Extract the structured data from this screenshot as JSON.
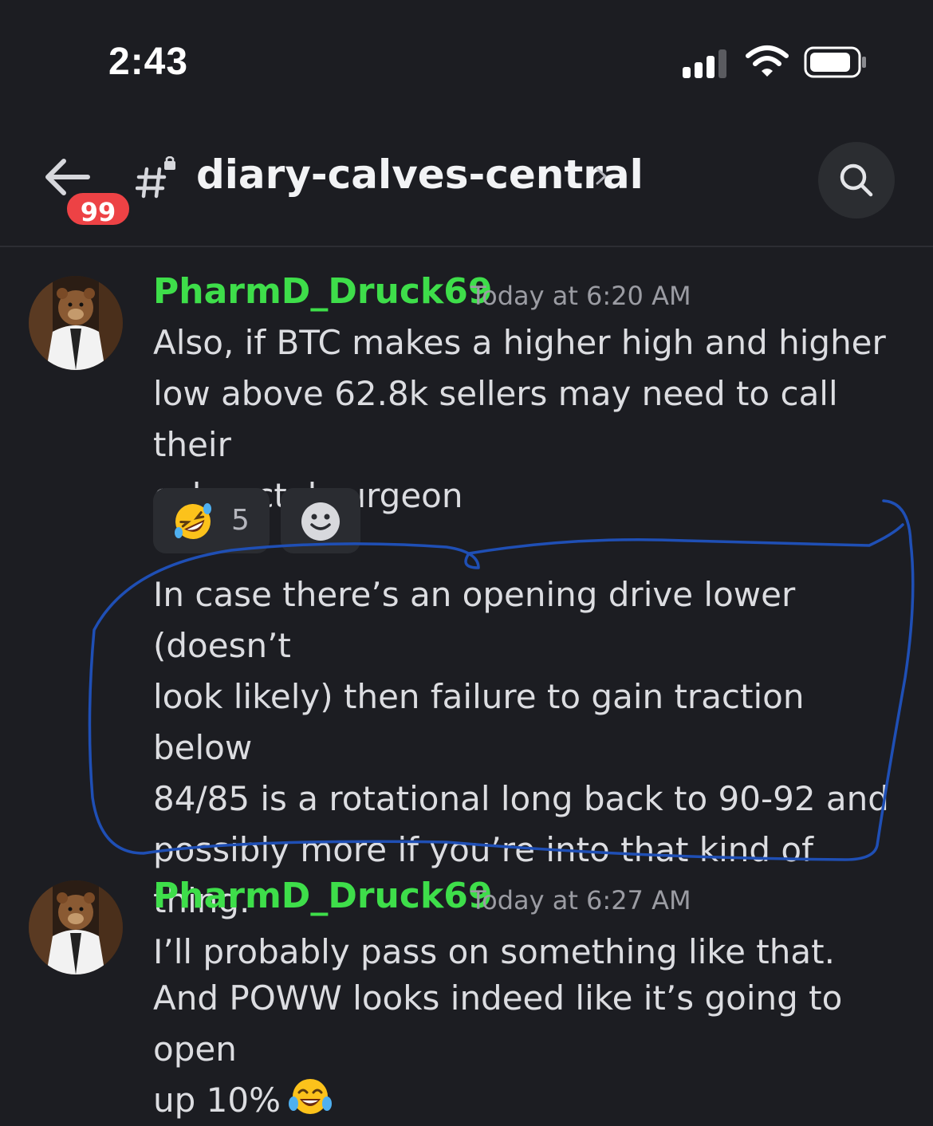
{
  "status_bar": {
    "time": "2:43"
  },
  "header": {
    "unread_badge": "99",
    "channel_name": "diary-calves-central",
    "icons": {
      "back": "arrow-left-icon",
      "channel": "locked-hashtag-icon",
      "chevron": "chevron-right-icon",
      "search": "search-icon"
    }
  },
  "messages": [
    {
      "username": "PharmD_Druck69",
      "timestamp": "Today at 6:20 AM",
      "text": "Also, if BTC makes a higher high and higher\nlow above 62.8k sellers may need to call their\ncolorectal surgeon",
      "reactions": [
        {
          "emoji": "rolling-on-floor-laughing-emoji",
          "count": "5"
        }
      ]
    },
    {
      "text": "In case there’s an opening drive lower (doesn’t\nlook likely) then failure to gain traction below\n84/85 is a rotational long back to 90-92 and\npossibly more if you’re into that kind of thing.\nI’ll probably pass on something like that."
    },
    {
      "username": "PharmD_Druck69",
      "timestamp": "Today at 6:27 AM",
      "text": "And POWW looks indeed like it’s going to open\nup 10%",
      "trailing_emoji": "joy-emoji"
    }
  ],
  "colors": {
    "background": "#1c1d22",
    "username": "#3ede4a",
    "badge": "#ed4245",
    "annotation_stroke": "#1f4fb5"
  }
}
